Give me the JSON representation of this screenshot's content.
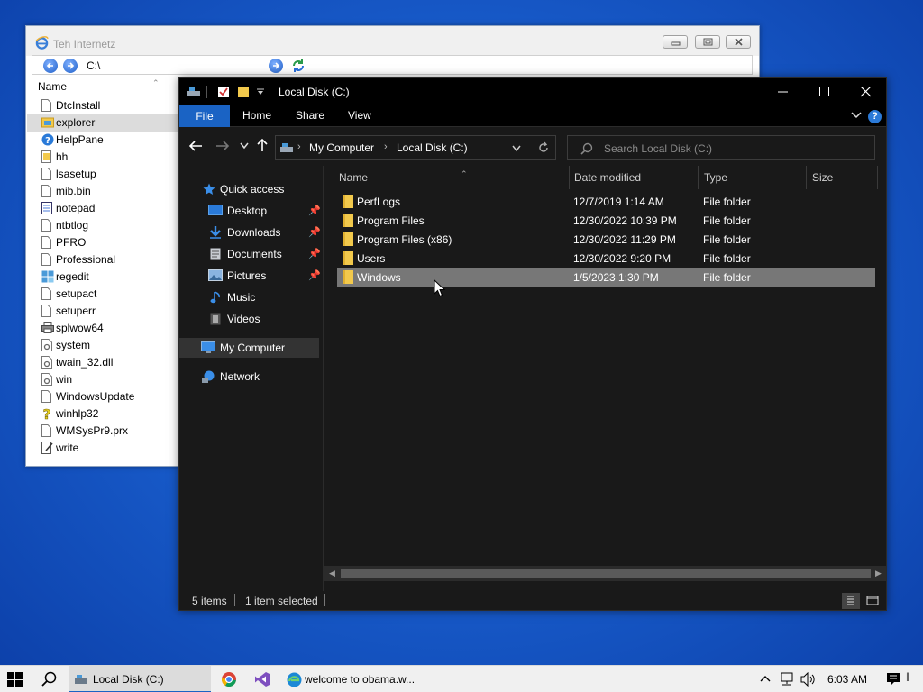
{
  "ie_window": {
    "title": "Teh Internetz",
    "address": "C:\\",
    "column_name": "Name",
    "items": [
      {
        "name": "DtcInstall",
        "icon": "file-icon"
      },
      {
        "name": "explorer",
        "icon": "explorer-folder-icon",
        "selected": true
      },
      {
        "name": "HelpPane",
        "icon": "help-icon"
      },
      {
        "name": "hh",
        "icon": "help-file-icon"
      },
      {
        "name": "lsasetup",
        "icon": "file-icon"
      },
      {
        "name": "mib.bin",
        "icon": "file-icon"
      },
      {
        "name": "notepad",
        "icon": "notepad-icon"
      },
      {
        "name": "ntbtlog",
        "icon": "file-icon"
      },
      {
        "name": "PFRO",
        "icon": "file-icon"
      },
      {
        "name": "Professional",
        "icon": "file-icon"
      },
      {
        "name": "regedit",
        "icon": "regedit-icon"
      },
      {
        "name": "setupact",
        "icon": "file-icon"
      },
      {
        "name": "setuperr",
        "icon": "file-icon"
      },
      {
        "name": "splwow64",
        "icon": "printer-icon"
      },
      {
        "name": "system",
        "icon": "settings-file-icon"
      },
      {
        "name": "twain_32.dll",
        "icon": "settings-file-icon"
      },
      {
        "name": "win",
        "icon": "settings-file-icon"
      },
      {
        "name": "WindowsUpdate",
        "icon": "file-icon"
      },
      {
        "name": "winhlp32",
        "icon": "help-question-icon"
      },
      {
        "name": "WMSysPr9.prx",
        "icon": "file-icon"
      },
      {
        "name": "write",
        "icon": "write-icon"
      }
    ]
  },
  "explorer": {
    "title": "Local Disk (C:)",
    "ribbon_tabs": {
      "file": "File",
      "home": "Home",
      "share": "Share",
      "view": "View"
    },
    "help_label": "?",
    "breadcrumb": [
      "My Computer",
      "Local Disk (C:)"
    ],
    "search_placeholder": "Search Local Disk (C:)",
    "nav": {
      "quick_access": "Quick access",
      "desktop": "Desktop",
      "downloads": "Downloads",
      "documents": "Documents",
      "pictures": "Pictures",
      "music": "Music",
      "videos": "Videos",
      "my_computer": "My Computer",
      "network": "Network"
    },
    "columns": {
      "name": "Name",
      "date_modified": "Date modified",
      "type": "Type",
      "size": "Size"
    },
    "rows": [
      {
        "name": "PerfLogs",
        "date": "12/7/2019 1:14 AM",
        "type": "File folder"
      },
      {
        "name": "Program Files",
        "date": "12/30/2022 10:39 PM",
        "type": "File folder"
      },
      {
        "name": "Program Files (x86)",
        "date": "12/30/2022 11:29 PM",
        "type": "File folder"
      },
      {
        "name": "Users",
        "date": "12/30/2022 9:20 PM",
        "type": "File folder"
      },
      {
        "name": "Windows",
        "date": "1/5/2023 1:30 PM",
        "type": "File folder",
        "selected": true
      }
    ],
    "status": {
      "items": "5 items",
      "selected": "1 item selected"
    }
  },
  "taskbar": {
    "tasks": [
      {
        "label": "Local Disk (C:)",
        "active": true
      },
      {
        "label": "welcome to obama.w...",
        "active": false
      }
    ],
    "clock": "6:03 AM"
  },
  "colors": {
    "accent": "#1a63c4",
    "explorer_bg": "#191919",
    "selection_row": "#777777",
    "desktop": "#1a60d0"
  }
}
